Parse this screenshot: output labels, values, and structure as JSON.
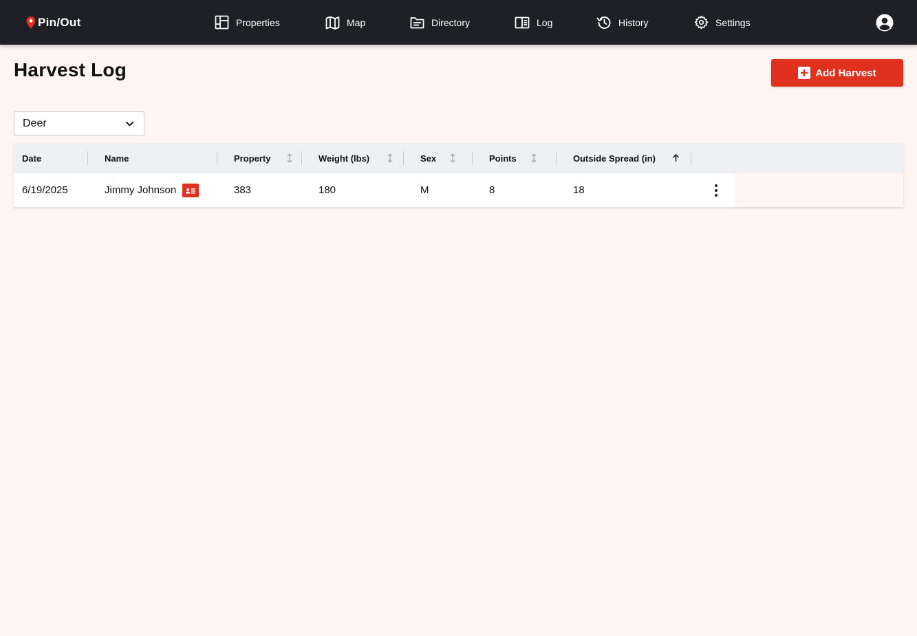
{
  "app": {
    "brand": "Pin/Out"
  },
  "nav": {
    "items": [
      {
        "label": "Properties",
        "icon": "layout-icon"
      },
      {
        "label": "Map",
        "icon": "map-icon"
      },
      {
        "label": "Directory",
        "icon": "folder-icon"
      },
      {
        "label": "Log",
        "icon": "book-icon"
      },
      {
        "label": "History",
        "icon": "history-icon"
      },
      {
        "label": "Settings",
        "icon": "gear-icon"
      }
    ]
  },
  "page": {
    "title": "Harvest Log",
    "add_button": "Add Harvest"
  },
  "filter": {
    "species_selected": "Deer"
  },
  "table": {
    "columns": [
      {
        "label": "Date",
        "sortable": false
      },
      {
        "label": "Name",
        "sortable": false
      },
      {
        "label": "Property",
        "sortable": true
      },
      {
        "label": "Weight (lbs)",
        "sortable": true
      },
      {
        "label": "Sex",
        "sortable": true
      },
      {
        "label": "Points",
        "sortable": true
      },
      {
        "label": "Outside Spread (in)",
        "sortable": true,
        "sorted": "asc"
      }
    ],
    "rows": [
      {
        "date": "6/19/2025",
        "name": "Jimmy Johnson",
        "property": "383",
        "weight": "180",
        "sex": "M",
        "points": "8",
        "outside_spread": "18"
      }
    ]
  },
  "colors": {
    "topbar": "#1f2026",
    "accent": "#e0311f",
    "background": "#fff6f4",
    "header_row": "#eff0f3"
  }
}
